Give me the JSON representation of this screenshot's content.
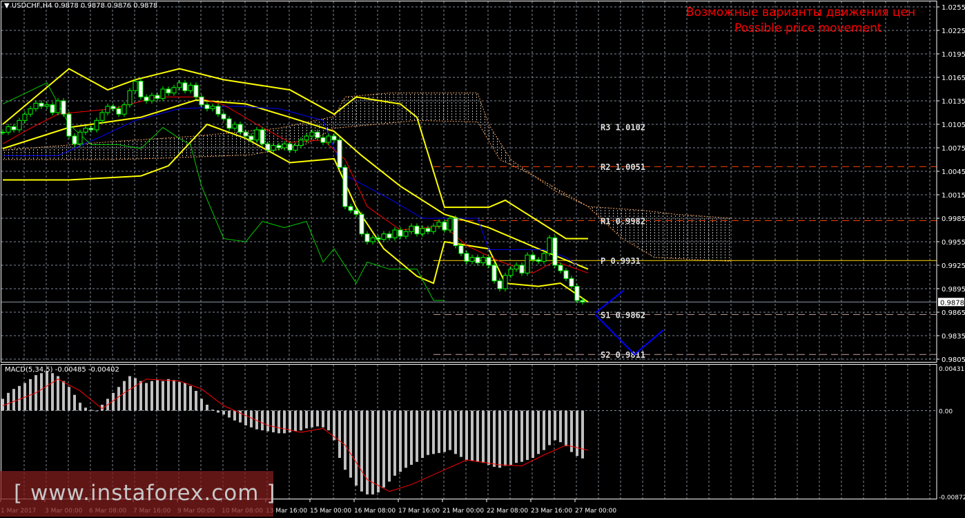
{
  "header": {
    "symbol": "USDCHF,H4",
    "ohlc": "0.9878 0.9878 0.9876 0.9878"
  },
  "annotation": {
    "line1": "Возможные варианты движения цен",
    "line2": "Possible price movement"
  },
  "watermark": "[ www.instaforex.com ]",
  "macd_label": "MACD(5,34,5) -0.00485 -0.00402",
  "colors": {
    "background": "#000000",
    "grid": "#7f8a99",
    "bollinger": "#ffff00",
    "tenkan": "#ff0000",
    "kijun": "#0000ff",
    "chikou": "#00cc00",
    "cloud": "#f4a460",
    "pivot": "#ffd700",
    "resistance": "#ff4500",
    "support": "#c8a0a0",
    "projection": "#0000ff",
    "annotation": "#ff0000",
    "macd_hist": "#c0c0c0",
    "macd_signal": "#ff0000"
  },
  "chart_data": [
    {
      "type": "candlestick",
      "title": "USDCHF,H4",
      "ylim": [
        0.9805,
        1.0255
      ],
      "y_ticks": [
        "1.0255",
        "1.0225",
        "1.0195",
        "1.0165",
        "1.0135",
        "1.0105",
        "1.0075",
        "1.0045",
        "1.0015",
        "0.9985",
        "0.9955",
        "0.9925",
        "0.9895",
        "0.9865",
        "0.9835",
        "0.9805"
      ],
      "current_price": "0.9878",
      "x_ticks": [
        {
          "bar": 0,
          "label": "1 Mar 2017"
        },
        {
          "bar": 8,
          "label": "3 Mar 00:00"
        },
        {
          "bar": 16,
          "label": "6 Mar 08:00"
        },
        {
          "bar": 24,
          "label": "7 Mar 16:00"
        },
        {
          "bar": 32,
          "label": "9 Mar 00:00"
        },
        {
          "bar": 40,
          "label": "10 Mar 08:00"
        },
        {
          "bar": 48,
          "label": "13 Mar 16:00"
        },
        {
          "bar": 56,
          "label": "15 Mar 00:00"
        },
        {
          "bar": 64,
          "label": "16 Mar 08:00"
        },
        {
          "bar": 72,
          "label": "17 Mar 16:00"
        },
        {
          "bar": 80,
          "label": "21 Mar 00:00"
        },
        {
          "bar": 88,
          "label": "22 Mar 08:00"
        },
        {
          "bar": 96,
          "label": "23 Mar 16:00"
        },
        {
          "bar": 104,
          "label": "27 Mar 00:00"
        }
      ],
      "closes": [
        1.0095,
        1.0102,
        1.0098,
        1.011,
        1.0118,
        1.0125,
        1.0132,
        1.0128,
        1.013,
        1.012,
        1.0135,
        1.0118,
        1.009,
        1.008,
        1.0095,
        1.01,
        1.0098,
        1.011,
        1.012,
        1.0128,
        1.0125,
        1.0118,
        1.013,
        1.0148,
        1.016,
        1.014,
        1.0135,
        1.0142,
        1.0138,
        1.015,
        1.0145,
        1.0152,
        1.0158,
        1.0148,
        1.0155,
        1.014,
        1.013,
        1.0125,
        1.0128,
        1.0118,
        1.0112,
        1.01,
        1.0105,
        1.0095,
        1.009,
        1.0085,
        1.0098,
        1.008,
        1.0072,
        1.0078,
        1.0075,
        1.008,
        1.0072,
        1.0078,
        1.0085,
        1.009,
        1.0095,
        1.0088,
        1.0082,
        1.009,
        1.0085,
        1.005,
        1.0,
        0.9995,
        0.999,
        0.9965,
        0.9955,
        0.996,
        0.9958,
        0.9965,
        0.996,
        0.997,
        0.9962,
        0.9968,
        0.9975,
        0.9965,
        0.9972,
        0.9968,
        0.9975,
        0.998,
        0.997,
        0.9985,
        0.995,
        0.994,
        0.993,
        0.9935,
        0.9928,
        0.9935,
        0.9925,
        0.9905,
        0.9895,
        0.9912,
        0.992,
        0.9925,
        0.9915,
        0.9938,
        0.9932,
        0.993,
        0.994,
        0.996,
        0.9925,
        0.9918,
        0.9908,
        0.9898,
        0.988,
        0.9878
      ],
      "bollinger": {
        "upper": [
          [
            0,
            1.0105
          ],
          [
            12,
            1.0176
          ],
          [
            19,
            1.0149
          ],
          [
            24,
            1.0162
          ],
          [
            32,
            1.0176
          ],
          [
            40,
            1.0162
          ],
          [
            52,
            1.0149
          ],
          [
            60,
            1.0118
          ],
          [
            64,
            1.014
          ],
          [
            72,
            1.0131
          ],
          [
            75,
            1.0114
          ],
          [
            80,
            0.9999
          ],
          [
            88,
            0.9999
          ],
          [
            91,
            1.0008
          ],
          [
            102,
            0.9959
          ],
          [
            106,
            0.9959
          ]
        ],
        "middle": [
          [
            0,
            1.0074
          ],
          [
            12,
            1.0101
          ],
          [
            25,
            1.0114
          ],
          [
            35,
            1.0136
          ],
          [
            44,
            1.0131
          ],
          [
            52,
            1.0114
          ],
          [
            60,
            1.0096
          ],
          [
            65,
            1.0065
          ],
          [
            72,
            1.0026
          ],
          [
            80,
            0.999
          ],
          [
            88,
            0.9973
          ],
          [
            97,
            0.9946
          ],
          [
            106,
            0.992
          ]
        ],
        "lower": [
          [
            0,
            1.0034
          ],
          [
            12,
            1.0034
          ],
          [
            25,
            1.0039
          ],
          [
            30,
            1.0052
          ],
          [
            37,
            1.0105
          ],
          [
            44,
            1.0087
          ],
          [
            52,
            1.0056
          ],
          [
            60,
            1.0061
          ],
          [
            64,
            0.9999
          ],
          [
            69,
            0.9946
          ],
          [
            75,
            0.9911
          ],
          [
            78,
            0.9902
          ],
          [
            80,
            0.9955
          ],
          [
            88,
            0.9946
          ],
          [
            91,
            0.9902
          ],
          [
            97,
            0.9898
          ],
          [
            101,
            0.9902
          ],
          [
            106,
            0.9878
          ]
        ]
      },
      "ichimoku": {
        "tenkan": [
          [
            0,
            1.008
          ],
          [
            5,
            1.01
          ],
          [
            10,
            1.0118
          ],
          [
            20,
            1.0125
          ],
          [
            28,
            1.014
          ],
          [
            35,
            1.014
          ],
          [
            40,
            1.013
          ],
          [
            46,
            1.0105
          ],
          [
            52,
            1.0082
          ],
          [
            58,
            1.0085
          ],
          [
            62,
            1.006
          ],
          [
            66,
            1.0
          ],
          [
            72,
            0.997
          ],
          [
            80,
            0.9975
          ],
          [
            84,
            0.995
          ],
          [
            90,
            0.993
          ],
          [
            96,
            0.9915
          ],
          [
            100,
            0.993
          ],
          [
            106,
            0.9915
          ]
        ],
        "kijun": [
          [
            0,
            1.0065
          ],
          [
            10,
            1.0065
          ],
          [
            18,
            1.009
          ],
          [
            24,
            1.011
          ],
          [
            32,
            1.0125
          ],
          [
            42,
            1.0128
          ],
          [
            50,
            1.0125
          ],
          [
            58,
            1.011
          ],
          [
            62,
            1.004
          ],
          [
            66,
            1.0025
          ],
          [
            70,
            1.001
          ],
          [
            76,
            0.9985
          ],
          [
            86,
            0.9985
          ],
          [
            88,
            0.9945
          ],
          [
            98,
            0.9945
          ],
          [
            102,
            0.9935
          ],
          [
            104,
            0.9925
          ]
        ],
        "chikou": [
          [
            0,
            1.0131
          ],
          [
            8,
            1.0158
          ],
          [
            12,
            1.0105
          ],
          [
            16,
            1.0079
          ],
          [
            21,
            1.0079
          ],
          [
            25,
            1.0074
          ],
          [
            29,
            1.0101
          ],
          [
            32,
            1.0087
          ],
          [
            34,
            1.0079
          ],
          [
            36,
            1.0026
          ],
          [
            40,
            0.9959
          ],
          [
            44,
            0.9955
          ],
          [
            47,
            0.9981
          ],
          [
            51,
            0.9973
          ],
          [
            55,
            0.9981
          ],
          [
            58,
            0.9929
          ],
          [
            60,
            0.9946
          ],
          [
            64,
            0.9902
          ],
          [
            66,
            0.9929
          ],
          [
            70,
            0.992
          ],
          [
            75,
            0.992
          ],
          [
            78,
            0.988
          ],
          [
            80,
            0.988
          ]
        ],
        "span_a": [
          [
            0,
            1.0072
          ],
          [
            20,
            1.0083
          ],
          [
            35,
            1.009
          ],
          [
            50,
            1.01
          ],
          [
            60,
            1.0115
          ],
          [
            62,
            1.014
          ],
          [
            70,
            1.0145
          ],
          [
            86,
            1.0145
          ],
          [
            88,
            1.0105
          ],
          [
            92,
            1.006
          ],
          [
            100,
            1.002
          ],
          [
            106,
            1.0
          ],
          [
            116,
            0.9995
          ],
          [
            122,
            0.999
          ],
          [
            132,
            0.9985
          ]
        ],
        "span_b": [
          [
            0,
            1.006
          ],
          [
            20,
            1.006
          ],
          [
            30,
            1.0062
          ],
          [
            45,
            1.0066
          ],
          [
            55,
            1.008
          ],
          [
            60,
            1.01
          ],
          [
            75,
            1.011
          ],
          [
            86,
            1.0108
          ],
          [
            90,
            1.006
          ],
          [
            96,
            1.004
          ],
          [
            106,
            1.0
          ],
          [
            112,
            0.996
          ],
          [
            118,
            0.9935
          ],
          [
            126,
            0.9932
          ],
          [
            132,
            0.993
          ]
        ]
      },
      "pivots": [
        {
          "label": "R3",
          "value": "1.0102",
          "style": "none"
        },
        {
          "label": "R2",
          "value": "1.0051",
          "style": "resistance"
        },
        {
          "label": "R1",
          "value": "0.9982",
          "style": "resistance"
        },
        {
          "label": "P",
          "value": "0.9931",
          "style": "pivot"
        },
        {
          "label": "S1",
          "value": "0.9862",
          "style": "support"
        },
        {
          "label": "S2",
          "value": "0.9811",
          "style": "support"
        }
      ],
      "projection": [
        [
          [
            107.3,
            0.9864
          ],
          [
            112.5,
            0.9893
          ]
        ],
        [
          [
            107.3,
            0.9862
          ],
          [
            114.4,
            0.9811
          ],
          [
            119.6,
            0.9842
          ]
        ]
      ]
    },
    {
      "type": "bar",
      "title": "MACD(5,34,5)",
      "ylim": [
        -0.00872,
        0.00431
      ],
      "y_ticks": [
        "0.00431",
        "0.00",
        "-0.00872"
      ],
      "histogram": [
        0.0012,
        0.0018,
        0.0022,
        0.0025,
        0.0028,
        0.0032,
        0.0036,
        0.0038,
        0.004,
        0.0038,
        0.0035,
        0.003,
        0.0024,
        0.0016,
        0.0008,
        0.0003,
        0.0001,
        0.0,
        0.0006,
        0.0012,
        0.0018,
        0.0024,
        0.003,
        0.0035,
        0.0033,
        0.003,
        0.0028,
        0.003,
        0.0031,
        0.003,
        0.0032,
        0.0031,
        0.0029,
        0.0028,
        0.0025,
        0.002,
        0.0012,
        0.0006,
        0.0001,
        -0.0002,
        -0.0004,
        -0.0007,
        -0.001,
        -0.0012,
        -0.0015,
        -0.0017,
        -0.0019,
        -0.002,
        -0.0021,
        -0.0022,
        -0.0023,
        -0.0023,
        -0.0022,
        -0.0021,
        -0.002,
        -0.0018,
        -0.0017,
        -0.0016,
        -0.0017,
        -0.002,
        -0.003,
        -0.0048,
        -0.006,
        -0.0068,
        -0.0076,
        -0.0082,
        -0.0085,
        -0.0085,
        -0.0083,
        -0.0078,
        -0.0072,
        -0.0066,
        -0.0062,
        -0.0058,
        -0.0055,
        -0.0052,
        -0.0048,
        -0.0045,
        -0.0044,
        -0.0043,
        -0.0042,
        -0.004,
        -0.0044,
        -0.0047,
        -0.005,
        -0.0051,
        -0.0052,
        -0.0053,
        -0.0055,
        -0.0057,
        -0.0058,
        -0.0056,
        -0.0055,
        -0.0053,
        -0.0052,
        -0.005,
        -0.0048,
        -0.0044,
        -0.004,
        -0.0035,
        -0.003,
        -0.0032,
        -0.0036,
        -0.0042,
        -0.0046,
        -0.00485
      ],
      "signal": [
        [
          0,
          0.0005
        ],
        [
          6,
          0.0018
        ],
        [
          10,
          0.0032
        ],
        [
          14,
          0.002
        ],
        [
          18,
          0.0002
        ],
        [
          22,
          0.0018
        ],
        [
          26,
          0.0032
        ],
        [
          32,
          0.003
        ],
        [
          36,
          0.0022
        ],
        [
          40,
          0.0005
        ],
        [
          48,
          -0.0015
        ],
        [
          54,
          -0.0022
        ],
        [
          58,
          -0.0018
        ],
        [
          62,
          -0.0035
        ],
        [
          66,
          -0.007
        ],
        [
          70,
          -0.0082
        ],
        [
          74,
          -0.0075
        ],
        [
          80,
          -0.006
        ],
        [
          84,
          -0.005
        ],
        [
          90,
          -0.0055
        ],
        [
          94,
          -0.0056
        ],
        [
          98,
          -0.0045
        ],
        [
          102,
          -0.0035
        ],
        [
          106,
          -0.00402
        ]
      ]
    }
  ]
}
